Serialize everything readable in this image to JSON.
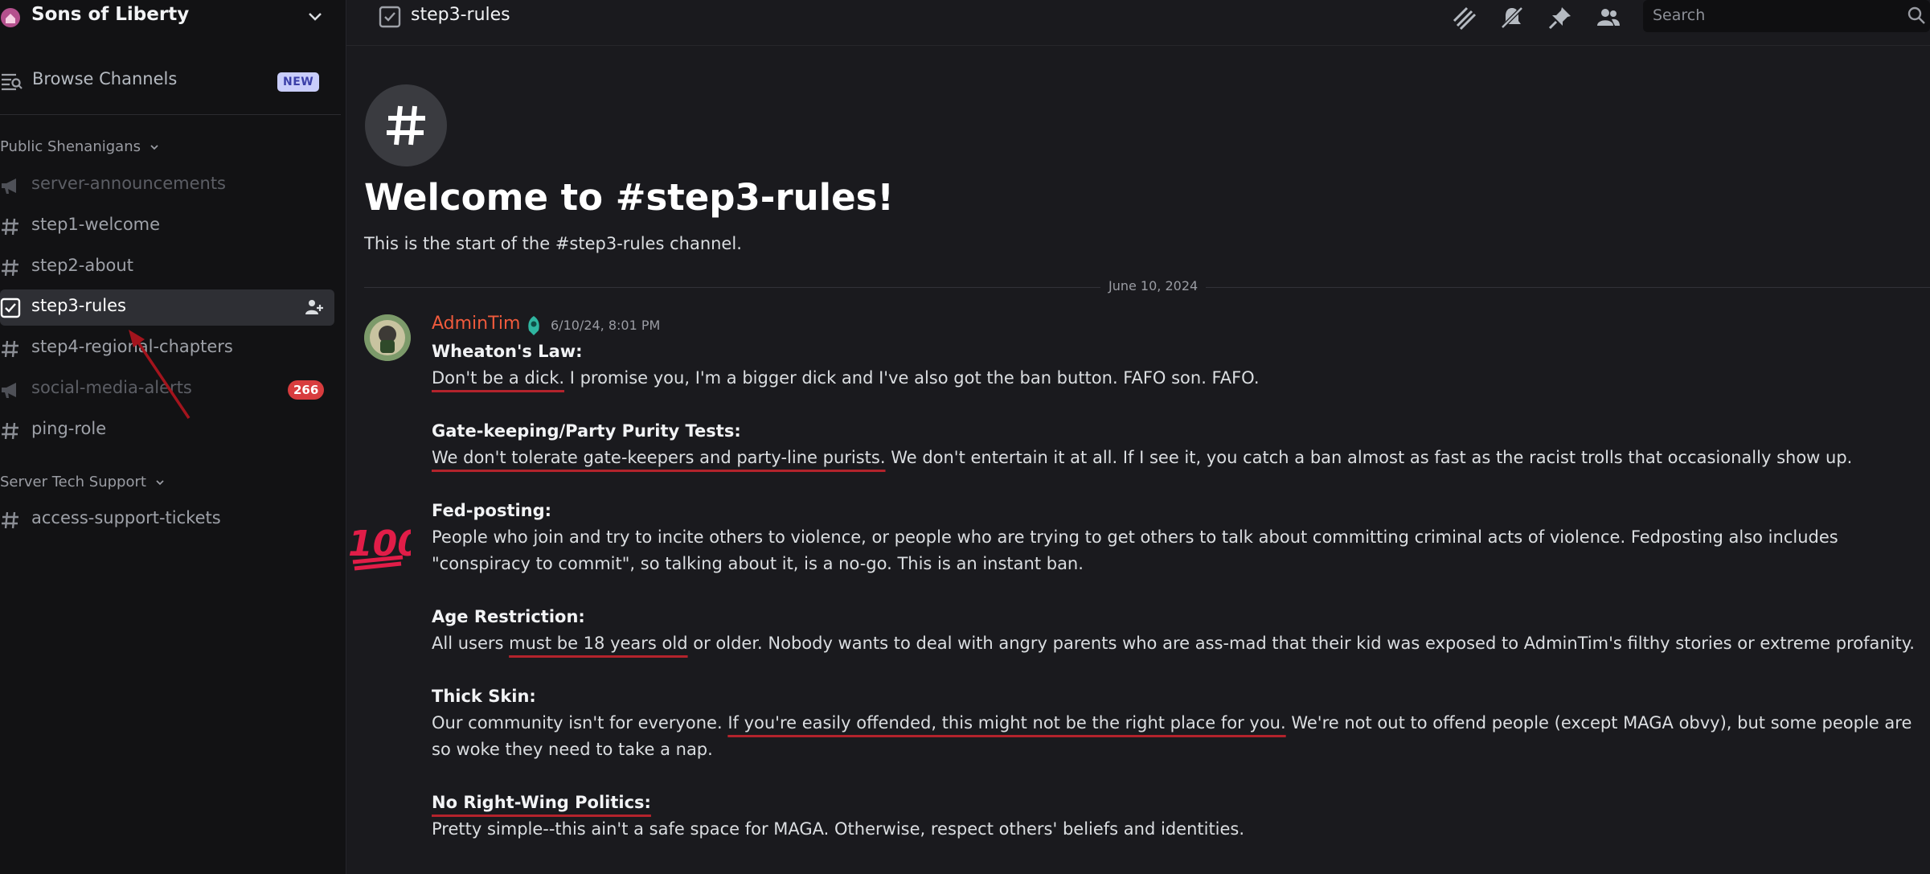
{
  "server": {
    "name": "Sons of Liberty"
  },
  "sidebar": {
    "browse_label": "Browse Channels",
    "browse_badge": "NEW",
    "categories": [
      {
        "name": "Public Shenanigans",
        "channels": [
          {
            "name": "server-announcements",
            "icon": "announcement-icon",
            "muted": true
          },
          {
            "name": "step1-welcome",
            "icon": "hash-icon"
          },
          {
            "name": "step2-about",
            "icon": "hash-icon"
          },
          {
            "name": "step3-rules",
            "icon": "rules-icon",
            "active": true
          },
          {
            "name": "step4-regional-chapters",
            "icon": "hash-icon"
          },
          {
            "name": "social-media-alerts",
            "icon": "announcement-icon",
            "muted": true,
            "badge": "266"
          },
          {
            "name": "ping-role",
            "icon": "hash-icon"
          }
        ]
      },
      {
        "name": "Server Tech Support",
        "channels": [
          {
            "name": "access-support-tickets",
            "icon": "hash-icon"
          }
        ]
      }
    ]
  },
  "topbar": {
    "channel_name": "step3-rules",
    "search_placeholder": "Search",
    "icons": [
      "threads-icon",
      "mute-icon",
      "pin-icon",
      "members-icon"
    ]
  },
  "main": {
    "welcome_title": "Welcome to #step3-rules!",
    "welcome_sub": "This is the start of the #step3-rules channel.",
    "date_divider": "June 10, 2024",
    "message": {
      "author": "AdminTim",
      "timestamp": "6/10/24, 8:01 PM",
      "rules": [
        {
          "title": "Wheaton's Law:",
          "underlined": "Don't be a dick.",
          "rest": " I promise you, I'm a bigger dick and I've also got the ban button. FAFO son. FAFO."
        },
        {
          "title": "Gate-keeping/Party Purity Tests:",
          "underlined": "We don't tolerate gate-keepers and party-line purists.",
          "rest": "  We don't entertain it at all.  If I see it, you catch a ban almost as fast as the racist trolls that occasionally show up."
        },
        {
          "title": "Fed-posting:",
          "pre": "",
          "underlined": "",
          "rest": "People who join and try to incite others to violence, or people who are trying to get others to talk about committing criminal acts of violence.  Fedposting also includes \"conspiracy to commit\", so talking about it, is a no-go. This is an instant ban."
        },
        {
          "title": "Age Restriction:",
          "pre": "All users ",
          "underlined": "must be 18 years old",
          "rest": " or older. Nobody wants to deal with angry parents who are ass-mad that their kid was exposed to AdminTim's filthy stories or extreme profanity."
        },
        {
          "title": "Thick Skin:",
          "pre": "Our community isn't for everyone. ",
          "underlined": "If you're easily offended, this might not be the right place for you.",
          "rest": " We're not out to offend people (except MAGA obvy), but some people are so woke they need to take a nap."
        },
        {
          "title": "No Right-Wing Politics:",
          "underlined": "",
          "rest": "Pretty simple--this ain't a safe space for MAGA. Otherwise, respect others' beliefs and identities."
        }
      ]
    }
  },
  "colors": {
    "author": "#ef5a3c",
    "badge_red": "#d83c3e",
    "new_badge": "#c9cdfb",
    "underline_marker": "#b3232c"
  }
}
